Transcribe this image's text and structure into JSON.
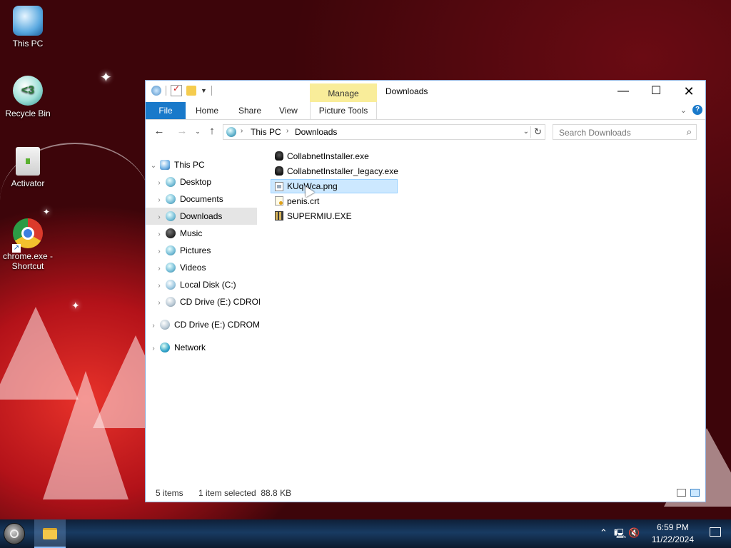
{
  "desktop": {
    "icons": [
      {
        "label": "This PC"
      },
      {
        "label": "Recycle Bin"
      },
      {
        "label": "Activator"
      },
      {
        "label": "chrome.exe - Shortcut"
      }
    ]
  },
  "window": {
    "title": "Downloads",
    "context_tab_header": "Manage",
    "ribbon_tabs": [
      "File",
      "Home",
      "Share",
      "View",
      "Picture Tools"
    ],
    "address": {
      "crumbs": [
        "This PC",
        "Downloads"
      ]
    },
    "search": {
      "placeholder": "Search Downloads"
    },
    "nav": [
      {
        "label": "This PC",
        "icon": "this-pc-icon"
      },
      {
        "label": "Desktop",
        "icon": "desktop-folder-icon"
      },
      {
        "label": "Documents",
        "icon": "documents-folder-icon"
      },
      {
        "label": "Downloads",
        "icon": "downloads-folder-icon",
        "selected": true
      },
      {
        "label": "Music",
        "icon": "music-folder-icon"
      },
      {
        "label": "Pictures",
        "icon": "pictures-folder-icon"
      },
      {
        "label": "Videos",
        "icon": "videos-folder-icon"
      },
      {
        "label": "Local Disk (C:)",
        "icon": "local-disk-icon"
      },
      {
        "label": "CD Drive (E:) CDROI",
        "icon": "cd-drive-icon"
      },
      {
        "label": "CD Drive (E:) CDROM",
        "icon": "cd-drive-icon"
      },
      {
        "label": "Network",
        "icon": "network-icon"
      }
    ],
    "files": [
      {
        "name": "CollabnetInstaller.exe",
        "icon": "exe-file-icon"
      },
      {
        "name": "CollabnetInstaller_legacy.exe",
        "icon": "exe-file-icon"
      },
      {
        "name": "KUqWca.png",
        "icon": "png-file-icon",
        "selected": true
      },
      {
        "name": "penis.crt",
        "icon": "certificate-file-icon"
      },
      {
        "name": "SUPERMIU.EXE",
        "icon": "exe-file-icon"
      }
    ],
    "status": {
      "count": "5 items",
      "selection": "1 item selected  88.8 KB"
    }
  },
  "taskbar": {
    "time": "6:59 PM",
    "date": "11/22/2024",
    "tray_icons": [
      "chevron-up-icon",
      "network-icon",
      "volume-muted-icon",
      "notification-icon"
    ]
  },
  "colors": {
    "accent": "#1979ca",
    "selection": "#cce8ff",
    "manage_tab": "#f9ed9a"
  }
}
